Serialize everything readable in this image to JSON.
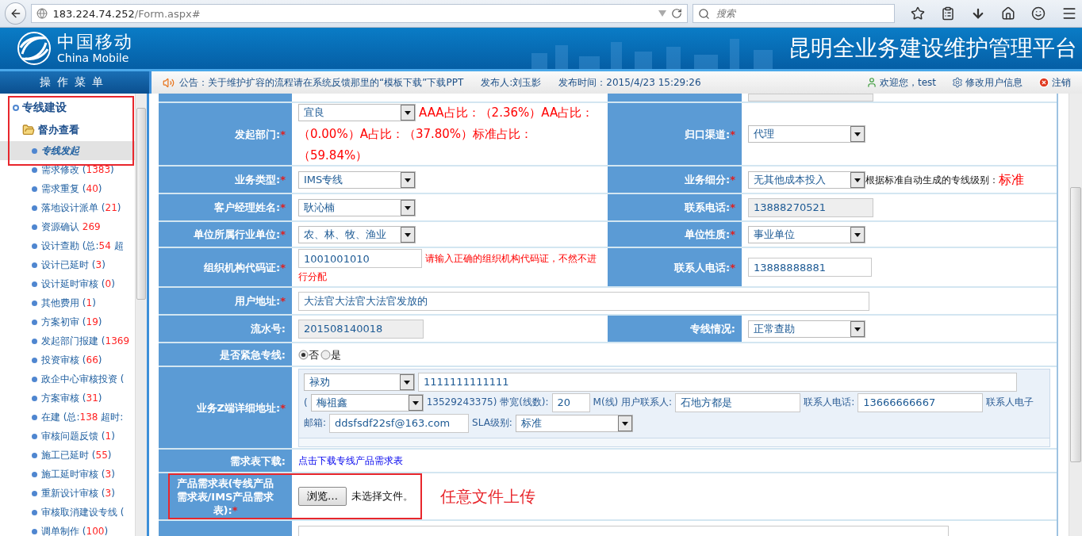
{
  "browser": {
    "url_host": "183.224.74.252",
    "url_path": "/Form.aspx#",
    "search_placeholder": "搜索"
  },
  "header": {
    "logo_cn": "中国移动",
    "logo_en": "China Mobile",
    "title": "昆明全业务建设维护管理平台"
  },
  "menu_title": "操作菜单",
  "notice": {
    "text": "公告：关于维护扩容的流程请在系统反馈那里的“模板下载”下载PPT",
    "publisher": "发布人:刘玉影",
    "time": "发布时间：2015/4/23 15:29:26"
  },
  "user_links": [
    {
      "kind": "user",
      "label": "欢迎您，test"
    },
    {
      "kind": "settings",
      "label": "修改用户信息"
    },
    {
      "kind": "logout",
      "label": "注销"
    }
  ],
  "sidebar": {
    "items": [
      {
        "label": "专线建设",
        "expanded": true,
        "children": [
          {
            "label": "督办查看",
            "expanded": true,
            "children": [
              {
                "label": "专线发起",
                "selected": true
              },
              {
                "label": "需求修改 (",
                "count": "1383",
                "tail": ")",
                "selected": false
              },
              {
                "label": "需求重复 (",
                "count": "40",
                "tail": ")",
                "selected": false
              },
              {
                "label": "落地设计派单 (",
                "count": "21",
                "tail": ")",
                "selected": false
              },
              {
                "label": "资源确认 ",
                "count": "269",
                "selected": false
              },
              {
                "label": "设计查勘 (总:",
                "count": "54",
                "tail": " 超",
                "selected": false
              },
              {
                "label": "设计已延时 (",
                "count": "3",
                "tail": ")",
                "selected": false
              },
              {
                "label": "设计延时审核 (",
                "count": "0",
                "tail": ")",
                "selected": false
              },
              {
                "label": "其他费用 (",
                "count": "1",
                "tail": ")",
                "selected": false
              },
              {
                "label": "方案初审 (",
                "count": "19",
                "tail": ")",
                "selected": false
              },
              {
                "label": "发起部门报建 (",
                "count": "1369",
                "selected": false
              },
              {
                "label": "投资审核 (",
                "count": "66",
                "tail": ")",
                "selected": false
              },
              {
                "label": "政企中心审核投资 (",
                "selected": false
              },
              {
                "label": "方案审核 (",
                "count": "31",
                "tail": ")",
                "selected": false
              },
              {
                "label": "在建 (总:",
                "count": "138",
                "tail": " 超时:",
                "selected": false
              },
              {
                "label": "审核问题反馈 (",
                "count": "1",
                "tail": ")",
                "selected": false
              },
              {
                "label": "施工已延时 (",
                "count": "55",
                "tail": ")",
                "selected": false
              },
              {
                "label": "施工延时审核 (",
                "count": "3",
                "tail": ")",
                "selected": false
              },
              {
                "label": "重新设计审核 (",
                "count": "3",
                "tail": ")",
                "selected": false
              },
              {
                "label": "审核取消建设专线 (",
                "selected": false
              },
              {
                "label": "调单制作 (",
                "count": "100",
                "tail": ")",
                "selected": false
              }
            ]
          }
        ]
      }
    ]
  },
  "form": {
    "rows": [
      {
        "kind": "cut"
      },
      {
        "kind": "pair",
        "cells": [
          {
            "label": "发起部门:",
            "asterisk": "*",
            "control": {
              "kind": "select",
              "value": "宜良"
            },
            "notes": [
              {
                "kind": "stat",
                "text": "AAA占比：（2.36%）AA占比："
              },
              {
                "kind": "stat",
                "text": "（0.00%）A占比：（37.80%）标准占比："
              },
              {
                "kind": "stat",
                "text": "（59.84%）"
              }
            ]
          },
          {
            "label": "归口渠道:",
            "asterisk": "*",
            "control": {
              "kind": "select",
              "value": "代理"
            }
          }
        ]
      },
      {
        "kind": "pair",
        "cells": [
          {
            "label": "业务类型:",
            "asterisk": "*",
            "control": {
              "kind": "select",
              "value": "IMS专线"
            }
          },
          {
            "label": "业务细分:",
            "asterisk": "*",
            "control": {
              "kind": "select",
              "value": "无其他成本投入"
            },
            "notes": [
              {
                "kind": "caption",
                "text": "根据标准自动生成的专线级别："
              },
              {
                "kind": "level",
                "text": "标准"
              }
            ]
          }
        ]
      },
      {
        "kind": "pair",
        "cells": [
          {
            "label": "客户经理姓名:",
            "asterisk": "*",
            "control": {
              "kind": "select",
              "value": "耿沁楠"
            }
          },
          {
            "label": "联系电话:",
            "asterisk": "*",
            "control": {
              "kind": "readonly",
              "value": "13888270521"
            }
          }
        ]
      },
      {
        "kind": "pair",
        "cells": [
          {
            "label": "单位所属行业单位:",
            "asterisk": "*",
            "control": {
              "kind": "select",
              "value": "农、林、牧、渔业"
            }
          },
          {
            "label": "单位性质:",
            "asterisk": "*",
            "control": {
              "kind": "select",
              "value": "事业单位"
            }
          }
        ]
      },
      {
        "kind": "pair",
        "cells": [
          {
            "label": "组织机构代码证:",
            "asterisk": "*",
            "control": {
              "kind": "input",
              "value": "1001001010"
            },
            "notes": [
              {
                "kind": "hint",
                "text": "请输入正确的组织机构代码证，不然不进"
              },
              {
                "kind": "hint",
                "text": "行分配"
              }
            ]
          },
          {
            "label": "联系人电话:",
            "asterisk": "*",
            "control": {
              "kind": "input",
              "value": "13888888881"
            }
          }
        ]
      },
      {
        "kind": "single",
        "cells": [
          {
            "label": "用户地址:",
            "asterisk": "*",
            "control": {
              "kind": "input",
              "value": "大法官大法官大法官发放的"
            }
          }
        ]
      },
      {
        "kind": "pair",
        "cells": [
          {
            "label": "流水号:",
            "control": {
              "kind": "readonly",
              "value": "201508140018"
            }
          },
          {
            "label": "专线情况:",
            "control": {
              "kind": "select",
              "value": "正常查勘"
            }
          }
        ]
      },
      {
        "kind": "single",
        "cells": [
          {
            "label": "是否紧急专线:",
            "control": {
              "kind": "radio",
              "options": [
                {
                  "label": "否",
                  "selected": true
                },
                {
                  "label": "是",
                  "selected": false
                }
              ]
            }
          }
        ]
      },
      {
        "kind": "single",
        "cells": [
          {
            "label": "业务Z端详细地址:",
            "asterisk": "*",
            "control": {
              "kind": "address",
              "lines": [
                [
                  {
                    "kind": "select",
                    "value": "禄劝"
                  },
                  {
                    "kind": "input",
                    "value": "1111111111111"
                  }
                ],
                [
                  {
                    "kind": "text",
                    "value": "("
                  },
                  {
                    "kind": "select",
                    "value": "梅祖鑫"
                  },
                  {
                    "kind": "text",
                    "value": "13529243375) 带宽(线数):"
                  },
                  {
                    "kind": "input",
                    "value": "20"
                  },
                  {
                    "kind": "text",
                    "value": "M(线) 用户联系人:"
                  },
                  {
                    "kind": "input",
                    "value": "石地方都是"
                  },
                  {
                    "kind": "text",
                    "value": "联系人电话:"
                  },
                  {
                    "kind": "input",
                    "value": "13666666667"
                  },
                  {
                    "kind": "text",
                    "value": "联系人电子"
                  }
                ],
                [
                  {
                    "kind": "text",
                    "value": "邮箱:"
                  },
                  {
                    "kind": "input",
                    "value": "ddsfsdf22sf@163.com"
                  },
                  {
                    "kind": "text",
                    "value": "SLA级别:"
                  },
                  {
                    "kind": "select",
                    "value": "标准"
                  }
                ]
              ]
            }
          }
        ]
      },
      {
        "kind": "single",
        "cells": [
          {
            "label": "需求表下载:",
            "control": {
              "kind": "link",
              "text": "点击下载专线产品需求表"
            }
          }
        ]
      },
      {
        "kind": "file",
        "cells": [
          {
            "label": "产品需求表(专线产品需求表/IMS产品需求表):",
            "asterisk": "*",
            "control": {
              "kind": "file",
              "button": "浏览…",
              "status": "未选择文件。",
              "annotation": "任意文件上传"
            }
          }
        ]
      },
      {
        "kind": "cut"
      }
    ]
  }
}
